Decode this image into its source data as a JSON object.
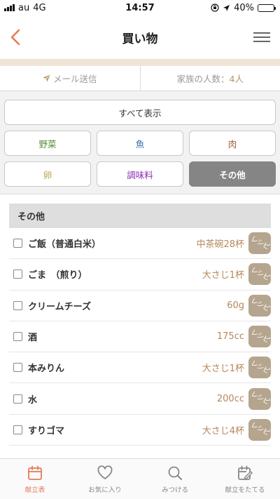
{
  "status_bar": {
    "carrier": "au",
    "network": "4G",
    "time": "14:57",
    "battery": "40%",
    "battery_level": 0.4
  },
  "header": {
    "title": "買い物",
    "back_icon": "chevron-left-icon",
    "menu_icon": "hamburger-icon"
  },
  "info": {
    "mail_label": "メール送信",
    "family_label": "家族の人数：",
    "family_value": "4人"
  },
  "filters": {
    "all_label": "すべて表示",
    "categories": [
      {
        "label": "野菜",
        "color": "#5a8c3a"
      },
      {
        "label": "魚",
        "color": "#3c6fb5"
      },
      {
        "label": "肉",
        "color": "#a0603a"
      },
      {
        "label": "卵",
        "color": "#b8a050"
      },
      {
        "label": "調味料",
        "color": "#8a2fb5"
      },
      {
        "label": "その他",
        "color": "#ffffff",
        "active": true
      }
    ]
  },
  "section": {
    "title": "その他",
    "recipe_label": "レシピ",
    "items": [
      {
        "name": "ご飯（普通白米）",
        "qty": "中茶碗28杯"
      },
      {
        "name": "ごま　（煎り）",
        "qty": "大さじ1杯"
      },
      {
        "name": "クリームチーズ",
        "qty": "60g"
      },
      {
        "name": "酒",
        "qty": "175cc"
      },
      {
        "name": "本みりん",
        "qty": "大さじ1杯"
      },
      {
        "name": "水",
        "qty": "200cc"
      },
      {
        "name": "すりゴマ",
        "qty": "大さじ4杯"
      }
    ]
  },
  "tabs": [
    {
      "label": "献立表",
      "icon": "calendar-icon",
      "active": true
    },
    {
      "label": "お気に入り",
      "icon": "heart-icon"
    },
    {
      "label": "みつける",
      "icon": "search-icon"
    },
    {
      "label": "献立をたてる",
      "icon": "calendar-edit-icon"
    }
  ],
  "colors": {
    "accent": "#e57a5a",
    "strip": "#efe5d6",
    "qty": "#b5875a",
    "recipe_button": "#b5a58e"
  }
}
